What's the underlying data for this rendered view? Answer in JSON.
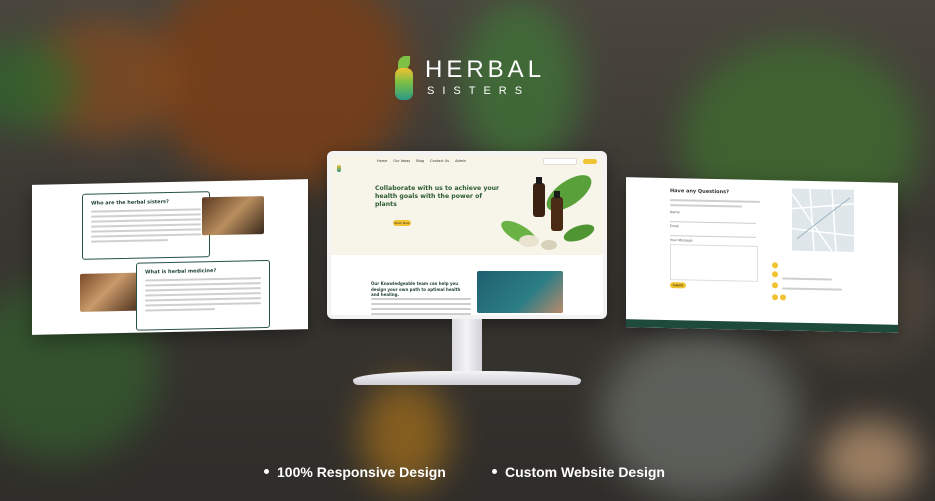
{
  "brand": {
    "name_line1": "HERBAL",
    "name_line2": "SISTERS"
  },
  "left_page": {
    "card1_title": "Who are the herbal sisters?",
    "card2_title": "What is herbal medicine?"
  },
  "monitor_site": {
    "nav_links": [
      "Home",
      "Our Ideas",
      "Blog",
      "Contact Us",
      "Admin"
    ],
    "nav_button": "Book Now",
    "hero_title": "Collaborate with us to achieve your health goals with the power of plants",
    "hero_button": "Book Now",
    "section2_title": "Our Knowledgeable team can help you design your own path to optimal health and healing."
  },
  "right_page": {
    "title": "Have any Questions?",
    "fields": [
      "Name",
      "Email",
      "Your Message"
    ],
    "submit": "Submit"
  },
  "features": [
    "100% Responsive Design",
    "Custom Website Design"
  ],
  "colors": {
    "accent_yellow": "#f1c232",
    "brand_green": "#2b5b33",
    "footer_green": "#1e4a3c"
  }
}
